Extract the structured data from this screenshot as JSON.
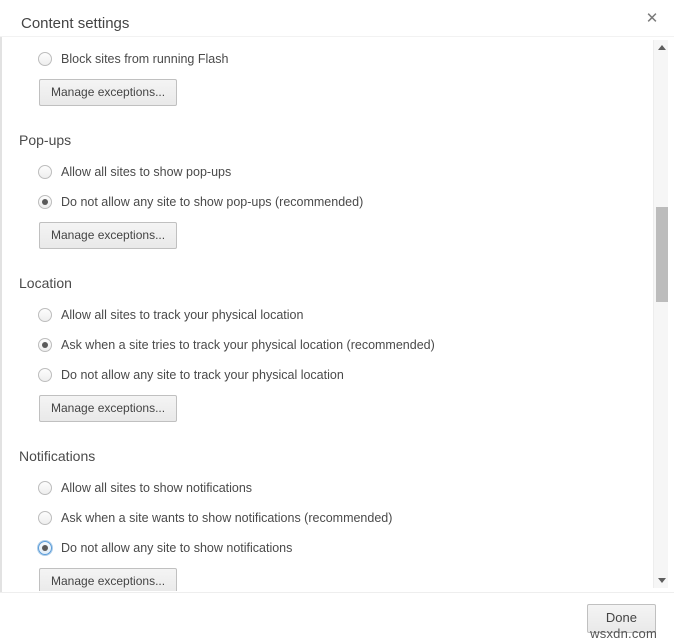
{
  "dialog": {
    "title": "Content settings",
    "close_icon": "close-icon"
  },
  "sections": [
    {
      "id": "flash",
      "heading": "",
      "options": [
        {
          "label": "Block sites from running Flash",
          "checked": false,
          "focused": false
        }
      ],
      "manage_label": "Manage exceptions..."
    },
    {
      "id": "popups",
      "heading": "Pop-ups",
      "options": [
        {
          "label": "Allow all sites to show pop-ups",
          "checked": false,
          "focused": false
        },
        {
          "label": "Do not allow any site to show pop-ups (recommended)",
          "checked": true,
          "focused": false
        }
      ],
      "manage_label": "Manage exceptions..."
    },
    {
      "id": "location",
      "heading": "Location",
      "options": [
        {
          "label": "Allow all sites to track your physical location",
          "checked": false,
          "focused": false
        },
        {
          "label": "Ask when a site tries to track your physical location (recommended)",
          "checked": true,
          "focused": false
        },
        {
          "label": "Do not allow any site to track your physical location",
          "checked": false,
          "focused": false
        }
      ],
      "manage_label": "Manage exceptions..."
    },
    {
      "id": "notifications",
      "heading": "Notifications",
      "options": [
        {
          "label": "Allow all sites to show notifications",
          "checked": false,
          "focused": false
        },
        {
          "label": "Ask when a site wants to show notifications (recommended)",
          "checked": false,
          "focused": false
        },
        {
          "label": "Do not allow any site to show notifications",
          "checked": true,
          "focused": true
        }
      ],
      "manage_label": "Manage exceptions..."
    }
  ],
  "scrollbar": {
    "up_icon": "chevron-up-icon",
    "down_icon": "chevron-down-icon"
  },
  "footer": {
    "done_label": "Done"
  },
  "watermark": {
    "text": "wsxdn.com"
  },
  "colors": {
    "accent_focus": "#5a9bd8",
    "radio_dot": "#5a5a5a",
    "text": "#4a4a4a",
    "scroll_thumb": "#bcbcbc"
  }
}
